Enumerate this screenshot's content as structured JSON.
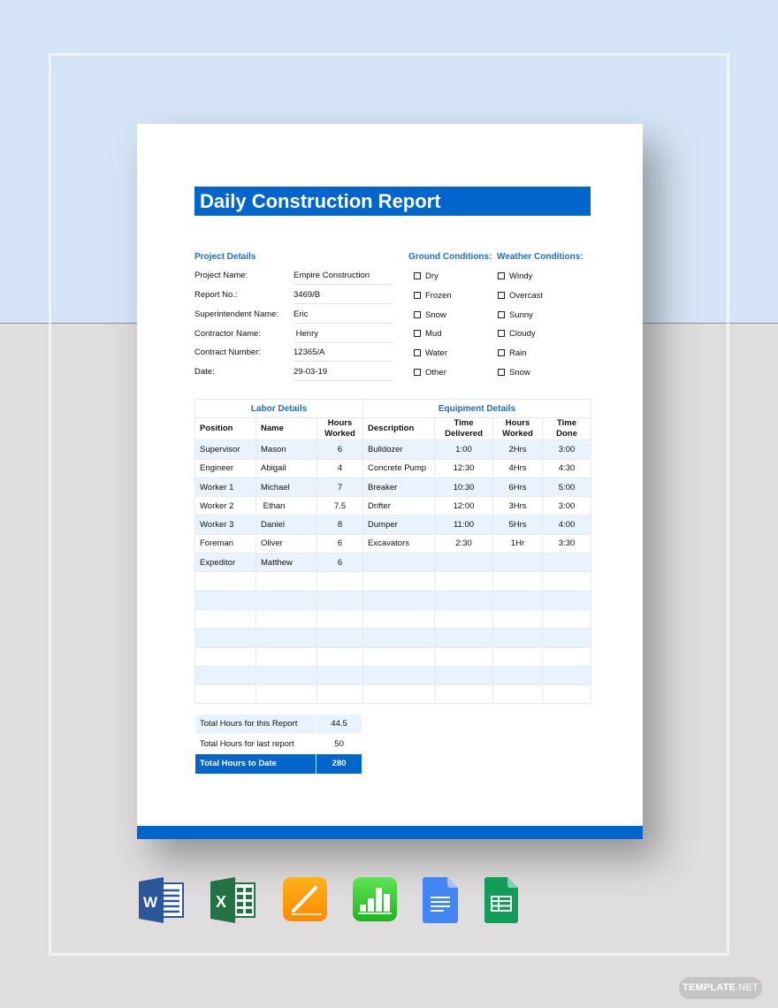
{
  "document": {
    "title": "Daily Construction Report",
    "project_details": {
      "heading": "Project Details",
      "fields": [
        {
          "label": "Project Name:",
          "value": "Empire Construction"
        },
        {
          "label": "Report No.:",
          "value": "3469/B"
        },
        {
          "label": "Superintendent Name:",
          "value": "Eric"
        },
        {
          "label": "Contractor Name:",
          "value": " Henry"
        },
        {
          "label": "Contract Number:",
          "value": "12365/A"
        },
        {
          "label": "Date:",
          "value": "29-03-19"
        }
      ]
    },
    "ground_conditions": {
      "heading": "Ground Conditions:",
      "options": [
        "Dry",
        "Frozen",
        "Snow",
        "Mud",
        "Water",
        "Other"
      ]
    },
    "weather_conditions": {
      "heading": "Weather Conditions:",
      "options": [
        "Windy",
        "Overcast",
        "Sunny",
        "Cloudy",
        "Rain",
        "Snow"
      ]
    },
    "labor": {
      "heading": "Labor Details",
      "columns": [
        "Position",
        "Name",
        "Hours Worked"
      ],
      "rows": [
        [
          "Supervisor",
          "Mason",
          "6"
        ],
        [
          "Engineer",
          "Abigail",
          "4"
        ],
        [
          "Worker 1",
          "Michael",
          "7"
        ],
        [
          "Worker 2",
          " Ethan",
          "7.5"
        ],
        [
          "Worker 3",
          "Daniel",
          "8"
        ],
        [
          "Foreman",
          "Oliver",
          "6"
        ],
        [
          "Expeditor",
          "Matthew",
          "6"
        ]
      ]
    },
    "equipment": {
      "heading": "Equipment Details",
      "columns": [
        "Description",
        "Time Delivered",
        "Hours Worked",
        "Time Done"
      ],
      "rows": [
        [
          "Bulldozer",
          "1:00",
          "2Hrs",
          "3:00"
        ],
        [
          "Concrete Pump",
          "12:30",
          "4Hrs",
          "4:30"
        ],
        [
          "Breaker",
          "10:30",
          "6Hrs",
          "5:00"
        ],
        [
          "Drifter",
          "12:00",
          "3Hrs",
          "3:00"
        ],
        [
          "Dumper",
          "11:00",
          "5Hrs",
          "4:00"
        ],
        [
          "Excavators",
          "2:30",
          "1Hr",
          "3:30"
        ]
      ]
    },
    "totals": [
      {
        "label": "Total Hours for this Report",
        "value": "44.5"
      },
      {
        "label": "Total Hours for last report",
        "value": "50"
      },
      {
        "label": "Total Hours to Date",
        "value": "280"
      }
    ]
  },
  "formats": [
    {
      "name": "Microsoft Word",
      "icon": "word-icon"
    },
    {
      "name": "Microsoft Excel",
      "icon": "excel-icon"
    },
    {
      "name": "Apple Pages",
      "icon": "pages-icon"
    },
    {
      "name": "Apple Numbers",
      "icon": "numbers-icon"
    },
    {
      "name": "Google Docs",
      "icon": "google-docs-icon"
    },
    {
      "name": "Google Sheets",
      "icon": "google-sheets-icon"
    }
  ],
  "watermark": {
    "bold": "TEMPLATE",
    "thin": ".NET"
  },
  "colors": {
    "accent": "#0066cc",
    "heading": "#1f6fc5",
    "row_alt": "#e9f3fd",
    "bg_top": "#d5e5f7",
    "bg_bottom": "#dfdddd"
  }
}
